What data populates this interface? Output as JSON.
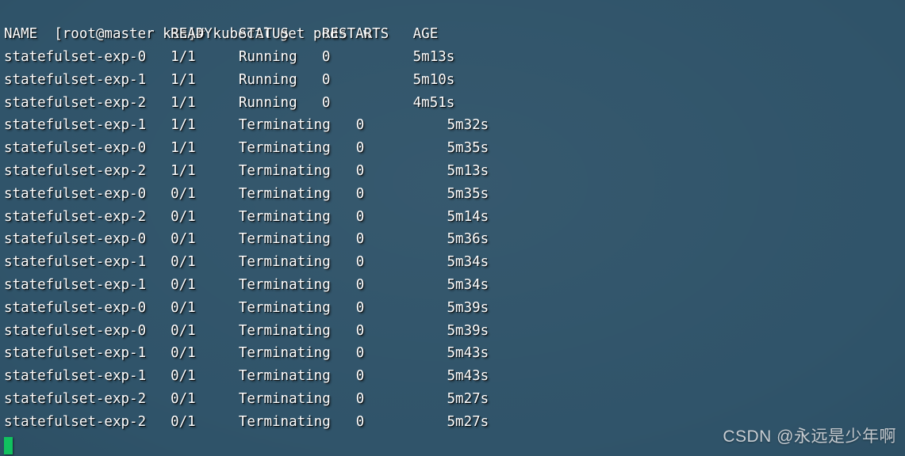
{
  "terminal": {
    "prompt": "[root@master k8s]# ",
    "command": "kubectl get pods -w",
    "cursor": "block-cursor",
    "colors": {
      "text": "#ffffff",
      "cursor": "#12c963",
      "background_light": "#3f6378",
      "background_dark": "#1d3344",
      "watermark": "#c9ced3"
    },
    "header": {
      "name": "NAME",
      "ready": "READY",
      "status": "STATUS",
      "restarts": "RESTARTS",
      "age": "AGE"
    },
    "rows": [
      {
        "name": "statefulset-exp-0",
        "ready": "1/1",
        "status": "Running",
        "restarts": "0",
        "age": "5m13s"
      },
      {
        "name": "statefulset-exp-1",
        "ready": "1/1",
        "status": "Running",
        "restarts": "0",
        "age": "5m10s"
      },
      {
        "name": "statefulset-exp-2",
        "ready": "1/1",
        "status": "Running",
        "restarts": "0",
        "age": "4m51s"
      },
      {
        "name": "statefulset-exp-1",
        "ready": "1/1",
        "status": "Terminating",
        "restarts": "0",
        "age": "5m32s"
      },
      {
        "name": "statefulset-exp-0",
        "ready": "1/1",
        "status": "Terminating",
        "restarts": "0",
        "age": "5m35s"
      },
      {
        "name": "statefulset-exp-2",
        "ready": "1/1",
        "status": "Terminating",
        "restarts": "0",
        "age": "5m13s"
      },
      {
        "name": "statefulset-exp-0",
        "ready": "0/1",
        "status": "Terminating",
        "restarts": "0",
        "age": "5m35s"
      },
      {
        "name": "statefulset-exp-2",
        "ready": "0/1",
        "status": "Terminating",
        "restarts": "0",
        "age": "5m14s"
      },
      {
        "name": "statefulset-exp-0",
        "ready": "0/1",
        "status": "Terminating",
        "restarts": "0",
        "age": "5m36s"
      },
      {
        "name": "statefulset-exp-1",
        "ready": "0/1",
        "status": "Terminating",
        "restarts": "0",
        "age": "5m34s"
      },
      {
        "name": "statefulset-exp-1",
        "ready": "0/1",
        "status": "Terminating",
        "restarts": "0",
        "age": "5m34s"
      },
      {
        "name": "statefulset-exp-0",
        "ready": "0/1",
        "status": "Terminating",
        "restarts": "0",
        "age": "5m39s"
      },
      {
        "name": "statefulset-exp-0",
        "ready": "0/1",
        "status": "Terminating",
        "restarts": "0",
        "age": "5m39s"
      },
      {
        "name": "statefulset-exp-1",
        "ready": "0/1",
        "status": "Terminating",
        "restarts": "0",
        "age": "5m43s"
      },
      {
        "name": "statefulset-exp-1",
        "ready": "0/1",
        "status": "Terminating",
        "restarts": "0",
        "age": "5m43s"
      },
      {
        "name": "statefulset-exp-2",
        "ready": "0/1",
        "status": "Terminating",
        "restarts": "0",
        "age": "5m27s"
      },
      {
        "name": "statefulset-exp-2",
        "ready": "0/1",
        "status": "Terminating",
        "restarts": "0",
        "age": "5m27s"
      }
    ]
  },
  "watermark": {
    "text": "CSDN @永远是少年啊"
  }
}
